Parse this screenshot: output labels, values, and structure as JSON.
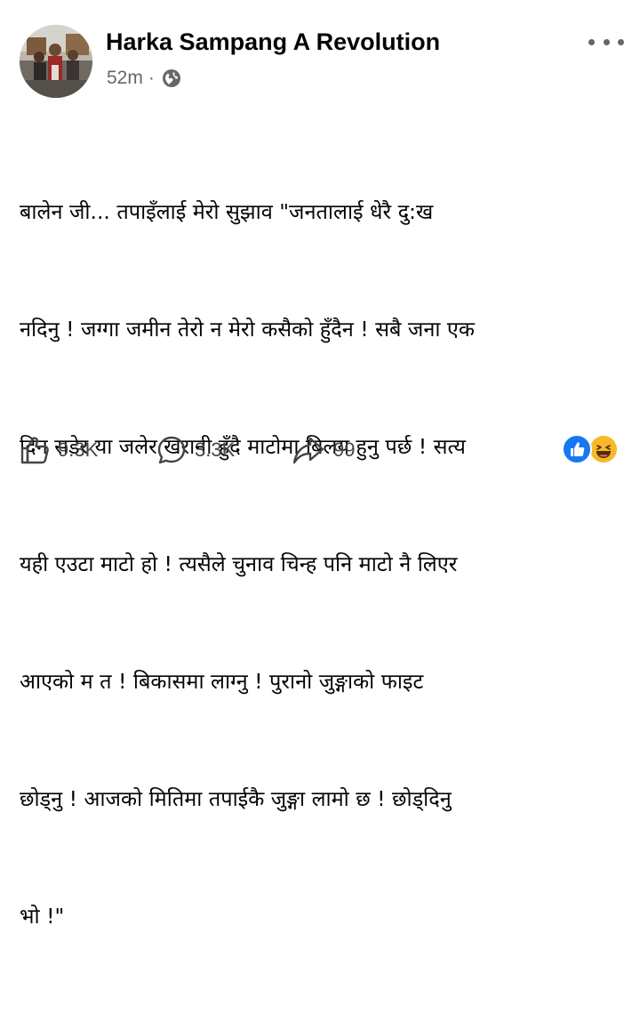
{
  "post": {
    "author": "Harka Sampang A Revolution",
    "timestamp": "52m",
    "separator": "·",
    "audience_icon": "globe-icon",
    "more_icon": "more-options-icon",
    "text_lines": [
      "बालेन जी... तपाइँलाई मेरो सुझाव \"जनतालाई धेरै दु:ख",
      "नदिनु ! जग्गा जमीन तेरो न मेरो कसैको हुँदैन ! सबै जना एक",
      "दिन सडेर या जलेर खरानी हुँदै माटोमा बिलय हुनु पर्छ ! सत्य",
      "यही एउटा माटो हो ! त्यसैले चुनाव चिन्ह पनि माटो नै लिएर",
      "आएको म त ! बिकासमा लाग्नु ! पुरानो जुङ्गाको फाइट",
      "छोड्नु ! आजको मितिमा तपाईकै जुङ्गा लामो छ ! छोड्दिनु",
      "भो !\""
    ]
  },
  "actions": {
    "like_count": "9.3K",
    "comment_count": "3.3K",
    "share_count": "99"
  },
  "reactions": [
    "like",
    "haha"
  ],
  "colors": {
    "like_blue": "#1877f2",
    "haha_yellow": "#f7b928",
    "secondary_text": "#65676b",
    "icon_gray": "#606770"
  }
}
